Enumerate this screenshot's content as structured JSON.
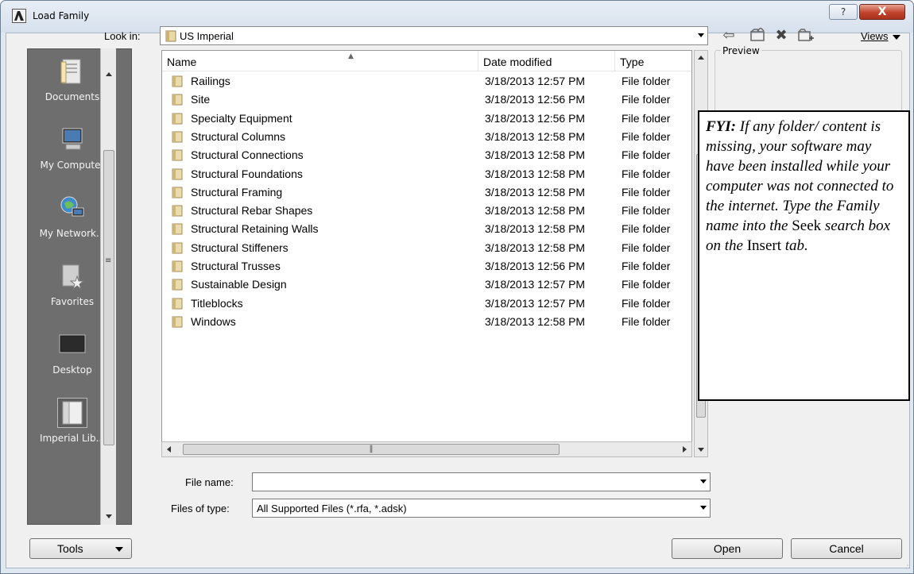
{
  "window": {
    "title": "Load Family",
    "help_label": "?",
    "close_label": "X"
  },
  "toolbar": {
    "look_in_label": "Look in:",
    "look_in_value": "US Imperial",
    "views_label": "Views"
  },
  "places": [
    {
      "label": "Documents",
      "icon": "documents-icon"
    },
    {
      "label": "My Computer",
      "icon": "computer-icon"
    },
    {
      "label": "My Network...",
      "icon": "network-icon"
    },
    {
      "label": "Favorites",
      "icon": "favorites-icon"
    },
    {
      "label": "Desktop",
      "icon": "desktop-icon"
    },
    {
      "label": "Imperial Lib...",
      "icon": "folder-icon"
    }
  ],
  "file_list": {
    "columns": [
      "Name",
      "Date modified",
      "Type"
    ],
    "rows": [
      {
        "name": "Railings",
        "date": "3/18/2013 12:57 PM",
        "type": "File folder"
      },
      {
        "name": "Site",
        "date": "3/18/2013 12:56 PM",
        "type": "File folder"
      },
      {
        "name": "Specialty Equipment",
        "date": "3/18/2013 12:56 PM",
        "type": "File folder"
      },
      {
        "name": "Structural Columns",
        "date": "3/18/2013 12:58 PM",
        "type": "File folder"
      },
      {
        "name": "Structural Connections",
        "date": "3/18/2013 12:58 PM",
        "type": "File folder"
      },
      {
        "name": "Structural Foundations",
        "date": "3/18/2013 12:58 PM",
        "type": "File folder"
      },
      {
        "name": "Structural Framing",
        "date": "3/18/2013 12:58 PM",
        "type": "File folder"
      },
      {
        "name": "Structural Rebar Shapes",
        "date": "3/18/2013 12:58 PM",
        "type": "File folder"
      },
      {
        "name": "Structural Retaining Walls",
        "date": "3/18/2013 12:58 PM",
        "type": "File folder"
      },
      {
        "name": "Structural Stiffeners",
        "date": "3/18/2013 12:58 PM",
        "type": "File folder"
      },
      {
        "name": "Structural Trusses",
        "date": "3/18/2013 12:56 PM",
        "type": "File folder"
      },
      {
        "name": "Sustainable Design",
        "date": "3/18/2013 12:57 PM",
        "type": "File folder"
      },
      {
        "name": "Titleblocks",
        "date": "3/18/2013 12:57 PM",
        "type": "File folder"
      },
      {
        "name": "Windows",
        "date": "3/18/2013 12:58 PM",
        "type": "File folder"
      }
    ]
  },
  "preview": {
    "label": "Preview"
  },
  "fyi": {
    "head": "FYI:",
    "text1": " If any folder/ content is missing, your software may have been installed while your computer was not connected to the internet. Type the Family name into the ",
    "seek": "Seek",
    "text2": " search box on the ",
    "insert": "Insert",
    "text3": " tab."
  },
  "form": {
    "file_name_label": "File name:",
    "file_name_value": "",
    "files_of_type_label": "Files of type:",
    "files_of_type_value": "All Supported Files  (*.rfa, *.adsk)"
  },
  "buttons": {
    "tools": "Tools",
    "open": "Open",
    "cancel": "Cancel"
  },
  "colors": {
    "places_bg": "#6e6e6e",
    "window_frame": "#dfe7f1",
    "close_red": "#c1432c"
  }
}
